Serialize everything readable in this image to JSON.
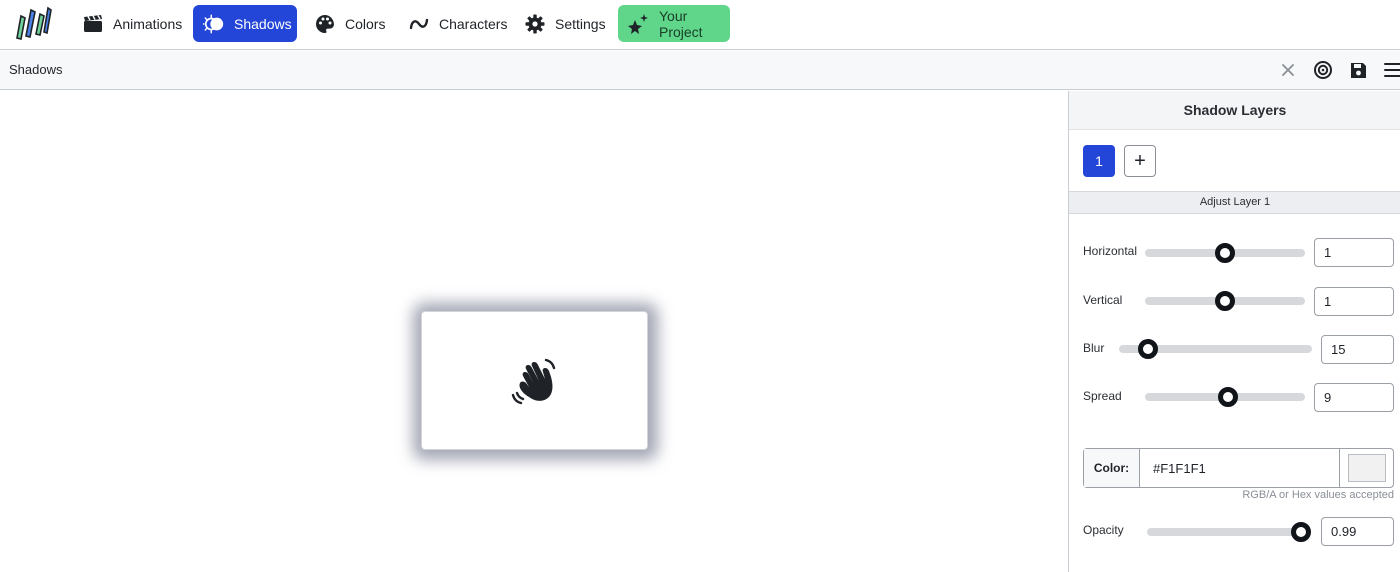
{
  "nav": {
    "items": [
      {
        "label": "Animations",
        "icon": "clapperboard-icon"
      },
      {
        "label": "Shadows",
        "icon": "shadow-icon",
        "active": true
      },
      {
        "label": "Colors",
        "icon": "palette-icon"
      },
      {
        "label": "Characters",
        "icon": "tilde-icon"
      },
      {
        "label": "Settings",
        "icon": "gear-icon"
      },
      {
        "label": "Your Project",
        "icon": "sparkle-stars-icon"
      }
    ]
  },
  "toolbar": {
    "title": "Shadows",
    "buttons": [
      "close-icon",
      "target-icon",
      "save-icon",
      "menu-icon"
    ]
  },
  "preview": {
    "icon": "waving-hand-icon"
  },
  "panel": {
    "title": "Shadow Layers",
    "layers": [
      "1"
    ],
    "add_label": "+",
    "adjust_title": "Adjust Layer 1",
    "controls": {
      "horizontal": {
        "label": "Horizontal",
        "value": "1",
        "level": 0.5
      },
      "vertical": {
        "label": "Vertical",
        "value": "1",
        "level": 0.5
      },
      "blur": {
        "label": "Blur",
        "value": "15",
        "level": 0.15
      },
      "spread": {
        "label": "Spread",
        "value": "9",
        "level": 0.52
      },
      "opacity": {
        "label": "Opacity",
        "value": "0.99",
        "level": 0.99
      }
    },
    "color": {
      "label": "Color:",
      "value": "#F1F1F1",
      "helper": "RGB/A or Hex values accepted"
    }
  },
  "colors": {
    "accent": "#2346d8",
    "project_button": "#5fd68a",
    "shadow_color": "#F1F1F1"
  }
}
